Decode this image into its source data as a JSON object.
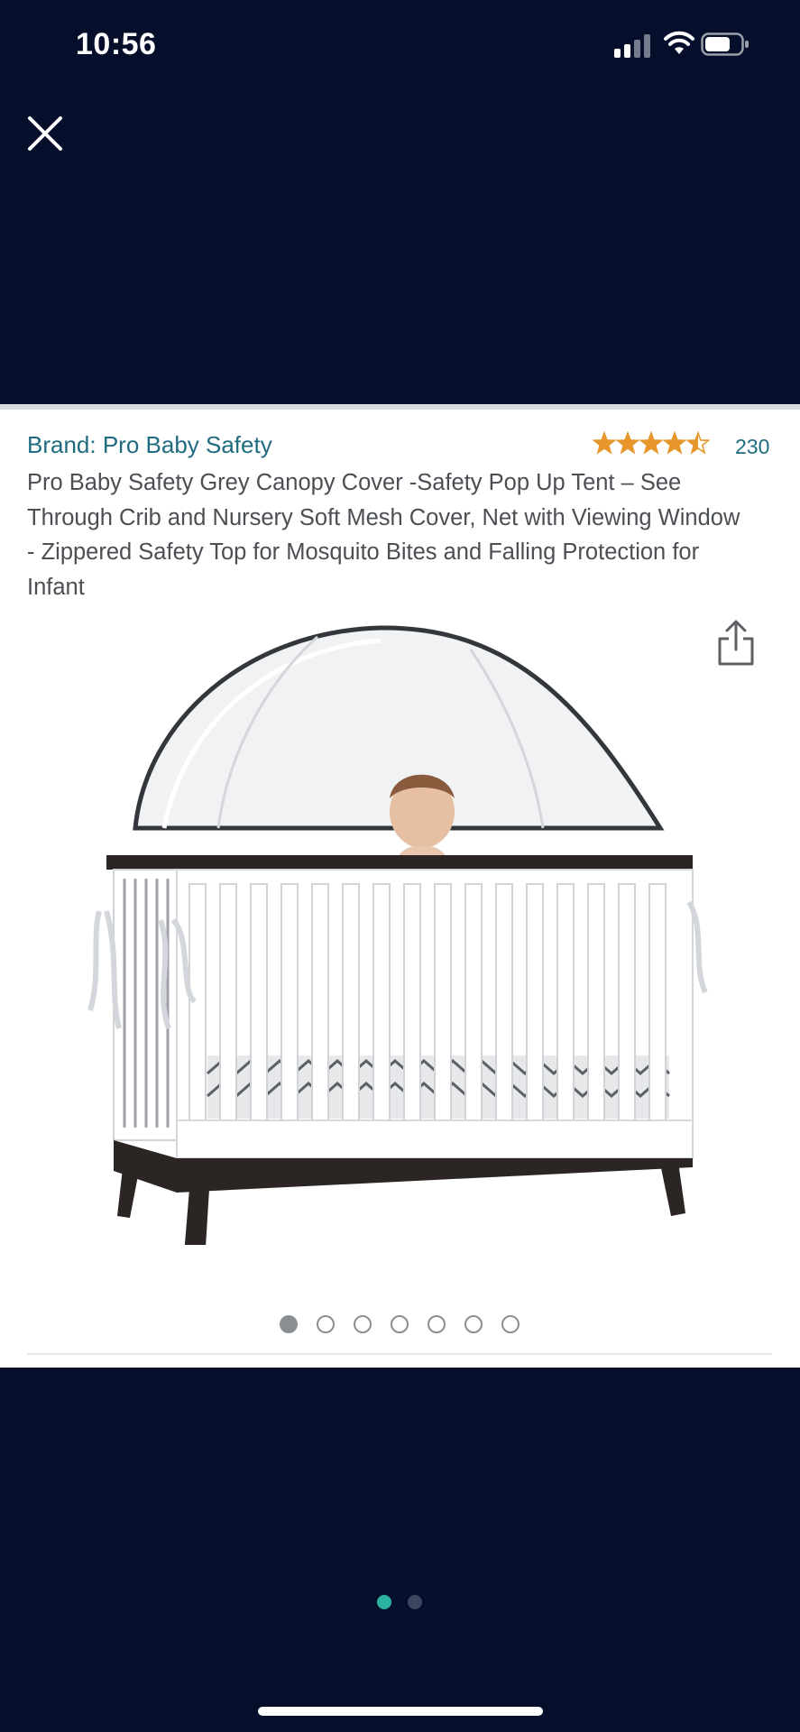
{
  "status_bar": {
    "time": "10:56",
    "signal_icon": "cellular-signal-icon",
    "wifi_icon": "wifi-icon",
    "battery_icon": "battery-icon"
  },
  "header": {
    "close_icon": "close-icon"
  },
  "product": {
    "brand_label": "Brand: Pro Baby Safety",
    "rating": 4.5,
    "rating_out_of": 5,
    "review_count": "230",
    "title": "Pro Baby Safety Grey Canopy Cover -Safety Pop Up Tent – See Through Crib and Nursery Soft Mesh Cover, Net with Viewing Window - Zippered Safety Top for Mosquito Bites and Falling Protection for Infant",
    "share_icon": "share-icon",
    "image_icon": "crib-canopy-product-image",
    "image_count": 7,
    "active_image_index": 0
  },
  "pager": {
    "page_count": 2,
    "active_page_index": 0
  },
  "colors": {
    "background": "#050f2b",
    "link": "#1f6b7f",
    "star": "#e6962b",
    "active_page_dot": "#2bb3a0",
    "inactive_page_dot": "#3a4560"
  }
}
